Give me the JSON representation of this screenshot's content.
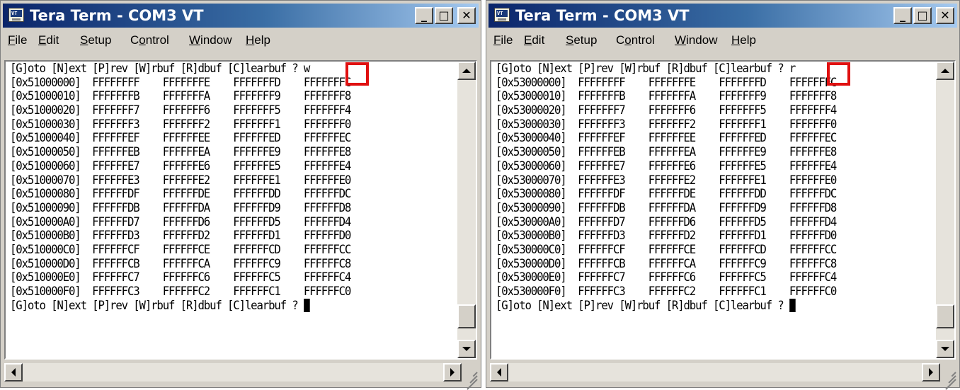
{
  "windows": [
    {
      "title": "Tera Term - COM3 VT",
      "menu": [
        "File",
        "Edit",
        "Setup",
        "Control",
        "Window",
        "Help"
      ],
      "command_char": "w",
      "lines": [
        "[G]oto [N]ext [P]rev [W]rbuf [R]dbuf [C]learbuf ? w",
        "[0x51000000]  FFFFFFFF    FFFFFFFE    FFFFFFFD    FFFFFFFC",
        "[0x51000010]  FFFFFFFB    FFFFFFFA    FFFFFFF9    FFFFFFF8",
        "[0x51000020]  FFFFFFF7    FFFFFFF6    FFFFFFF5    FFFFFFF4",
        "[0x51000030]  FFFFFFF3    FFFFFFF2    FFFFFFF1    FFFFFFF0",
        "[0x51000040]  FFFFFFEF    FFFFFFEE    FFFFFFED    FFFFFFEC",
        "[0x51000050]  FFFFFFEB    FFFFFFEA    FFFFFFE9    FFFFFFE8",
        "[0x51000060]  FFFFFFE7    FFFFFFE6    FFFFFFE5    FFFFFFE4",
        "[0x51000070]  FFFFFFE3    FFFFFFE2    FFFFFFE1    FFFFFFE0",
        "[0x51000080]  FFFFFFDF    FFFFFFDE    FFFFFFDD    FFFFFFDC",
        "[0x51000090]  FFFFFFDB    FFFFFFDA    FFFFFFD9    FFFFFFD8",
        "[0x510000A0]  FFFFFFD7    FFFFFFD6    FFFFFFD5    FFFFFFD4",
        "[0x510000B0]  FFFFFFD3    FFFFFFD2    FFFFFFD1    FFFFFFD0",
        "[0x510000C0]  FFFFFFCF    FFFFFFCE    FFFFFFCD    FFFFFFCC",
        "[0x510000D0]  FFFFFFCB    FFFFFFCA    FFFFFFC9    FFFFFFC8",
        "[0x510000E0]  FFFFFFC7    FFFFFFC6    FFFFFFC5    FFFFFFC4",
        "[0x510000F0]  FFFFFFC3    FFFFFFC2    FFFFFFC1    FFFFFFC0"
      ],
      "prompt": "[G]oto [N]ext [P]rev [W]rbuf [R]dbuf [C]learbuf ? "
    },
    {
      "title": "Tera Term - COM3 VT",
      "menu": [
        "File",
        "Edit",
        "Setup",
        "Control",
        "Window",
        "Help"
      ],
      "command_char": "r",
      "lines": [
        "[G]oto [N]ext [P]rev [W]rbuf [R]dbuf [C]learbuf ? r",
        "[0x53000000]  FFFFFFFF    FFFFFFFE    FFFFFFFD    FFFFFFFC",
        "[0x53000010]  FFFFFFFB    FFFFFFFA    FFFFFFF9    FFFFFFF8",
        "[0x53000020]  FFFFFFF7    FFFFFFF6    FFFFFFF5    FFFFFFF4",
        "[0x53000030]  FFFFFFF3    FFFFFFF2    FFFFFFF1    FFFFFFF0",
        "[0x53000040]  FFFFFFEF    FFFFFFEE    FFFFFFED    FFFFFFEC",
        "[0x53000050]  FFFFFFEB    FFFFFFEA    FFFFFFE9    FFFFFFE8",
        "[0x53000060]  FFFFFFE7    FFFFFFE6    FFFFFFE5    FFFFFFE4",
        "[0x53000070]  FFFFFFE3    FFFFFFE2    FFFFFFE1    FFFFFFE0",
        "[0x53000080]  FFFFFFDF    FFFFFFDE    FFFFFFDD    FFFFFFDC",
        "[0x53000090]  FFFFFFDB    FFFFFFDA    FFFFFFD9    FFFFFFD8",
        "[0x530000A0]  FFFFFFD7    FFFFFFD6    FFFFFFD5    FFFFFFD4",
        "[0x530000B0]  FFFFFFD3    FFFFFFD2    FFFFFFD1    FFFFFFD0",
        "[0x530000C0]  FFFFFFCF    FFFFFFCE    FFFFFFCD    FFFFFFCC",
        "[0x530000D0]  FFFFFFCB    FFFFFFCA    FFFFFFC9    FFFFFFC8",
        "[0x530000E0]  FFFFFFC7    FFFFFFC6    FFFFFFC5    FFFFFFC4",
        "[0x530000F0]  FFFFFFC3    FFFFFFC2    FFFFFFC1    FFFFFFC0"
      ],
      "prompt": "[G]oto [N]ext [P]rev [W]rbuf [R]dbuf [C]learbuf ? "
    }
  ],
  "icons": [
    "terminal-app-icon",
    "minimize-icon",
    "maximize-icon",
    "close-icon",
    "scroll-up-icon",
    "scroll-down-icon",
    "scroll-left-icon",
    "scroll-right-icon",
    "resize-grip-icon"
  ],
  "colors": {
    "title_active": "#0a246a",
    "title_fade": "#a6caf0",
    "highlight": "#e01010",
    "chrome": "#d4d0c8"
  }
}
